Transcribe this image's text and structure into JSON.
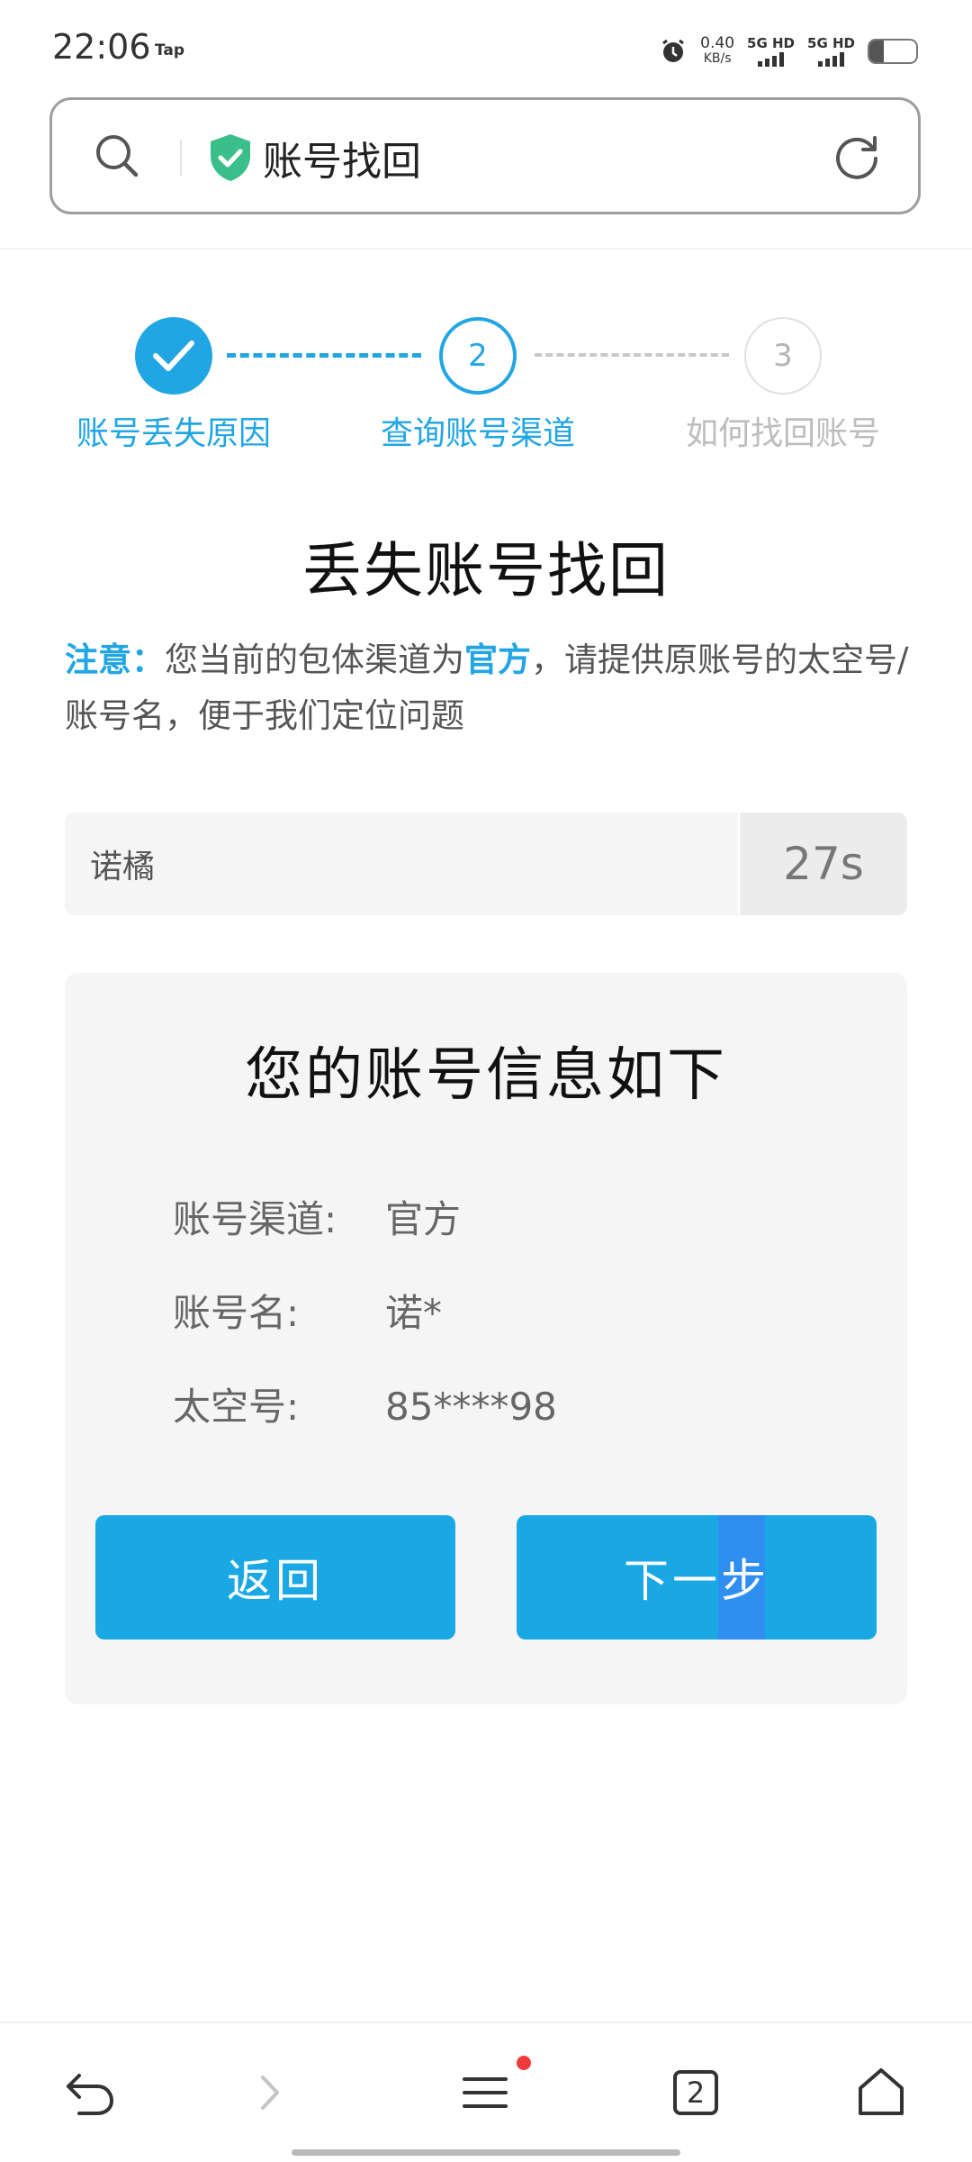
{
  "status_bar": {
    "time": "22:06",
    "app_tag": "Tap",
    "net_speed": "0.40",
    "net_unit": "KB/s",
    "sim1": "5G HD",
    "sim2": "5G HD",
    "battery_level": 0.3
  },
  "address_bar": {
    "title": "账号找回"
  },
  "steps": [
    {
      "label": "账号丢失原因",
      "state": "done"
    },
    {
      "label": "查询账号渠道",
      "number": "2",
      "state": "active"
    },
    {
      "label": "如何找回账号",
      "number": "3",
      "state": "pending"
    }
  ],
  "page": {
    "title": "丢失账号找回",
    "notice_label": "注意：",
    "notice_text_1": "您当前的包体渠道为",
    "notice_channel": "官方",
    "notice_text_2": "，请提供原账号的太空号/账号名，便于我们定位问题"
  },
  "account_input": {
    "value": "诺橘",
    "countdown": "27s"
  },
  "info_card": {
    "title": "您的账号信息如下",
    "rows": [
      {
        "key": "账号渠道:",
        "value": "官方"
      },
      {
        "key": "账号名:",
        "value": "诺*"
      },
      {
        "key": "太空号:",
        "value": "85****98"
      }
    ],
    "back_label": "返回",
    "next_label": "下一步"
  },
  "bottom_nav": {
    "tab_count": "2"
  },
  "colors": {
    "accent": "#22a6e3",
    "button": "#1aa8e5",
    "shield": "#3bbf8a",
    "badge": "#ef3b3b"
  }
}
